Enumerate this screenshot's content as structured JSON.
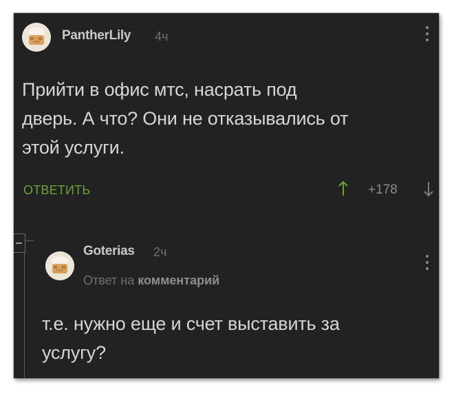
{
  "comment": {
    "username": "PantherLily",
    "time": "4ч",
    "text_lines": [
      "Прийти в офис мтс, насрать под",
      "дверь. А что? Они не отказывались от",
      "этой услуги."
    ],
    "reply_label": "ОТВЕТИТЬ",
    "score": "+178",
    "vote_up_icon": "arrow-up-icon",
    "vote_down_icon": "arrow-down-icon"
  },
  "reply": {
    "username": "Goterias",
    "time": "2ч",
    "reply_prefix": "Ответ на",
    "reply_target": "комментарий",
    "text_lines": [
      "т.е. нужно еще и счет выставить за",
      "услугу?"
    ]
  },
  "colors": {
    "background": "#222223",
    "accent_green": "#6aa335",
    "text": "#d6d6d6"
  }
}
